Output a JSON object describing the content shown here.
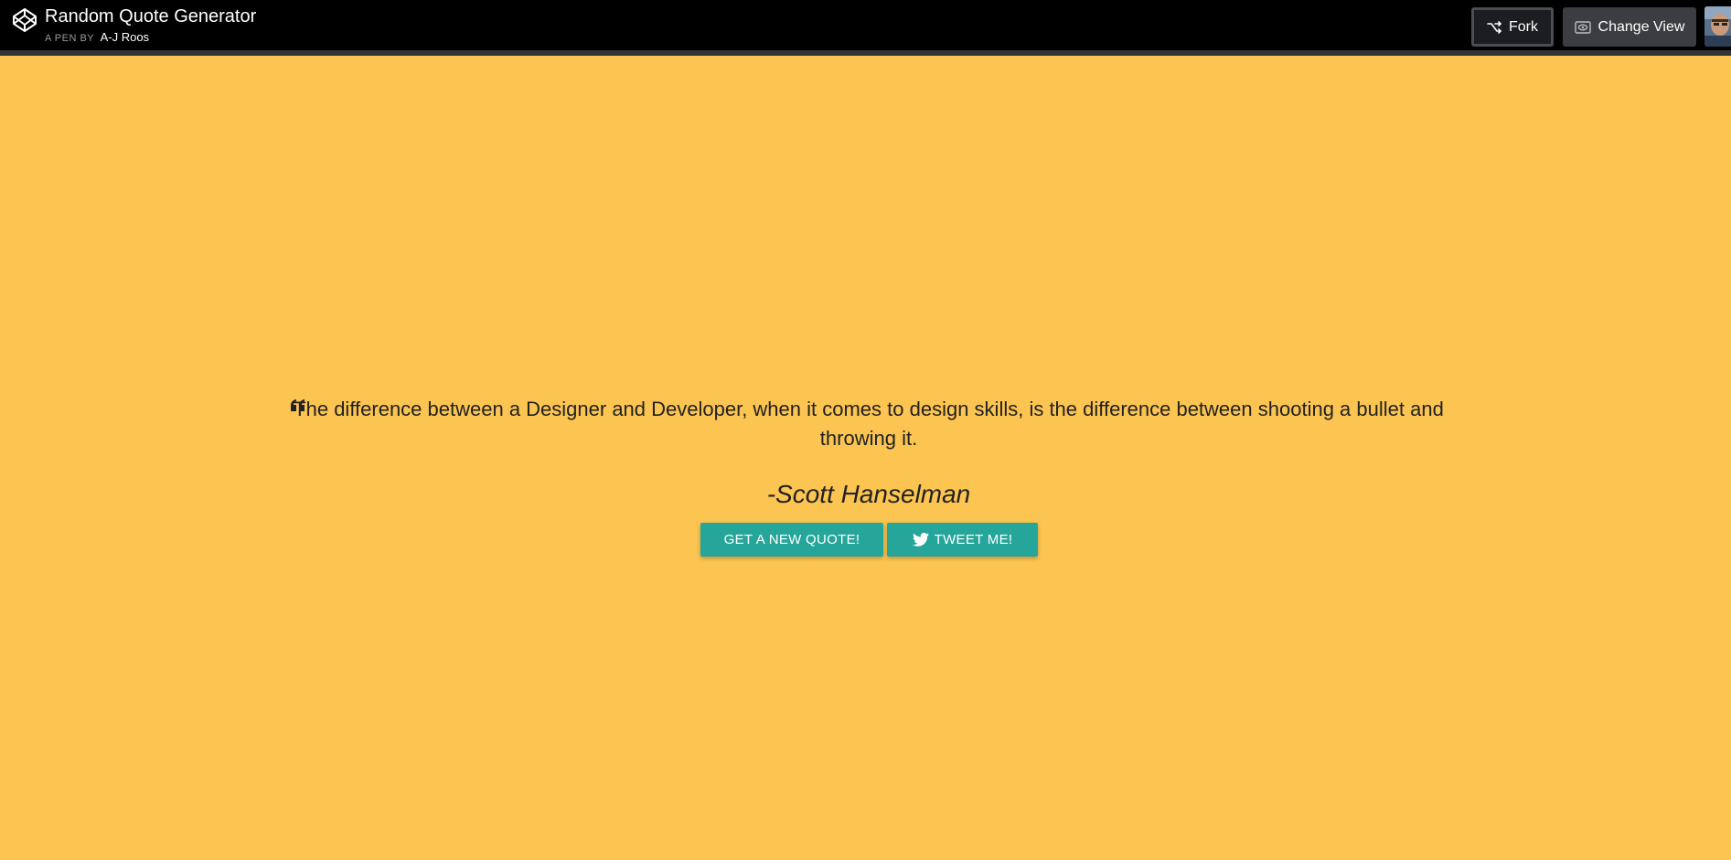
{
  "header": {
    "title": "Random Quote Generator",
    "by_label": "A PEN BY",
    "author": "A-J Roos",
    "logo_icon": "codepen-logo-icon",
    "fork_label": "Fork",
    "fork_icon": "fork-icon",
    "change_view_label": "Change View",
    "change_view_icon": "eye-icon",
    "avatar_icon": "user-avatar"
  },
  "main": {
    "quote_icon": "quote-left-icon",
    "quote": "The difference between a Designer and Developer, when it comes to design skills, is the difference between shooting a bullet and throwing it.",
    "author": "-Scott Hanselman",
    "new_quote_label": "GET A NEW QUOTE!",
    "tweet_label": "TWEET ME!",
    "tweet_icon": "twitter-icon"
  },
  "colors": {
    "background": "#fcc451",
    "topbar": "#000000",
    "button": "#26a69a",
    "text": "#222222"
  }
}
